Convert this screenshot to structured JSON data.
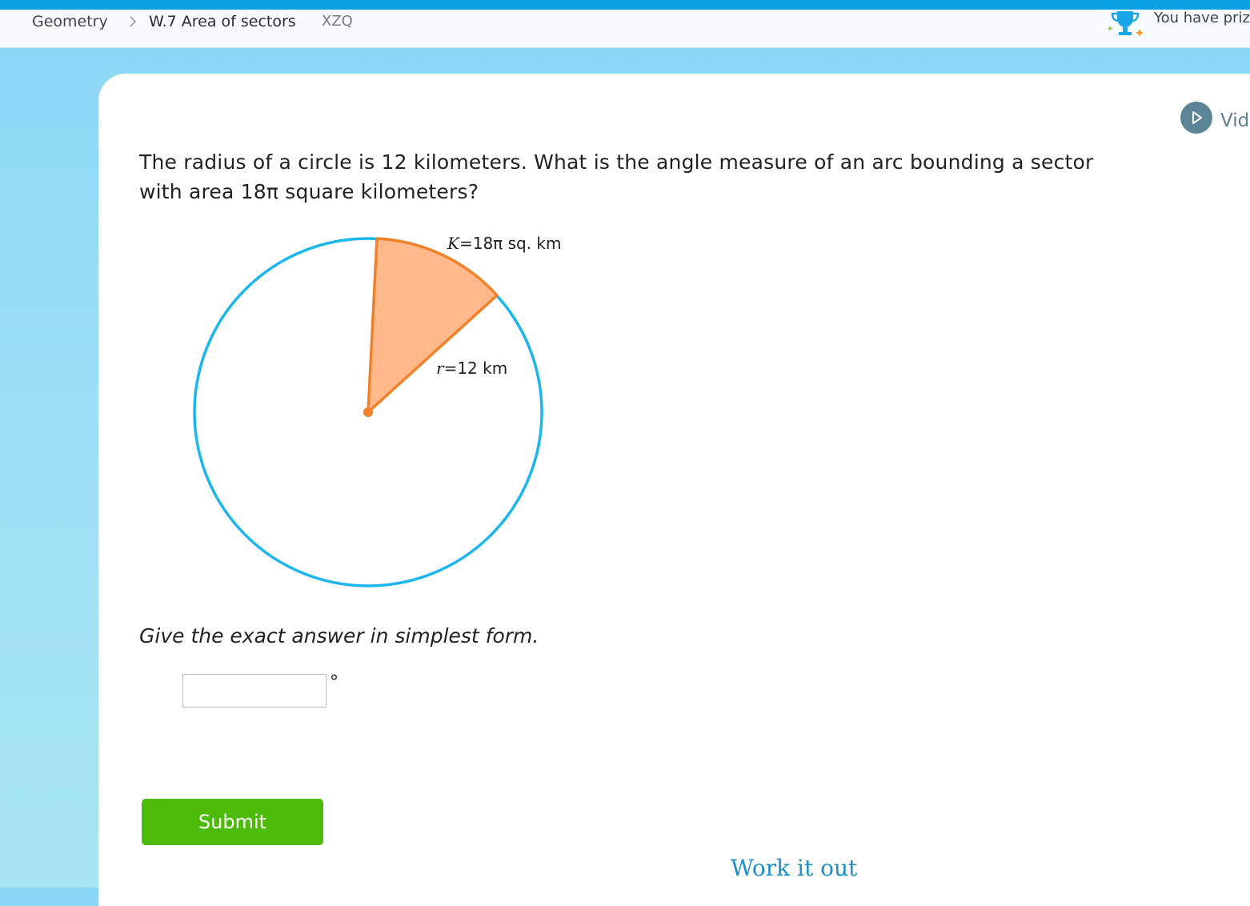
{
  "nav": {
    "subject": "Geometry",
    "skill": "W.7 Area of sectors",
    "code": "XZQ",
    "prize_text": "You have priz"
  },
  "video": {
    "label": "Vid"
  },
  "question": {
    "line1": "The radius of a circle is 12 kilometers. What is the angle measure of an arc bounding a sector",
    "line2": "with area 18π square kilometers?"
  },
  "figure": {
    "area_var": "K",
    "area_value": "18π sq. km",
    "radius_var": "r",
    "radius_value": "12 km",
    "colors": {
      "circle": "#1bb6ee",
      "sector_fill": "#ffb889",
      "sector_stroke": "#f0812b"
    }
  },
  "instruction": "Give the exact answer in simplest form.",
  "answer": {
    "value": "",
    "unit": "°"
  },
  "submit_label": "Submit",
  "work_it_out": "Work it out",
  "colors": {
    "submit": "#4dbb09",
    "link": "#1a8fc9",
    "topbar": "#0aa2e0"
  }
}
